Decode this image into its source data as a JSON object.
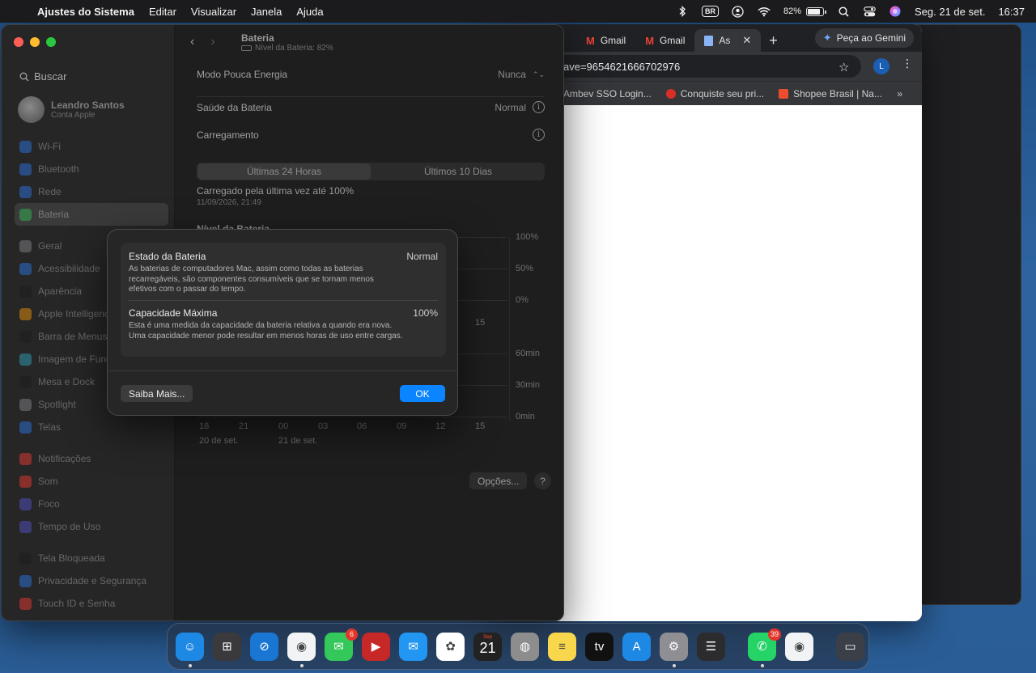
{
  "menubar": {
    "app_name": "Ajustes do Sistema",
    "menus": [
      "Editar",
      "Visualizar",
      "Janela",
      "Ajuda"
    ],
    "input_source": "BR",
    "battery_percent": "82%",
    "date": "Seg. 21 de set.",
    "time": "16:37"
  },
  "chrome": {
    "tabs": [
      {
        "label": "Gmail"
      },
      {
        "label": "Gmail"
      },
      {
        "label": "As"
      }
    ],
    "gemini_label": "Peça ao Gemini",
    "address": "ave=9654621666702976",
    "profile_initial": "L",
    "bookmarks": [
      {
        "label": "Ambev SSO Login...",
        "color": "#9e9e9e"
      },
      {
        "label": "Conquiste seu pri...",
        "color": "#d93025"
      },
      {
        "label": "Shopee Brasil | Na...",
        "color": "#ee4d2d"
      }
    ]
  },
  "sidebar": {
    "search_placeholder": "Buscar",
    "user_name": "Leandro Santos",
    "user_sub": "Conta Apple",
    "groups": [
      [
        {
          "label": "Wi-Fi",
          "color": "#2f7cf6"
        },
        {
          "label": "Bluetooth",
          "color": "#2f7cf6"
        },
        {
          "label": "Rede",
          "color": "#2f7cf6"
        },
        {
          "label": "Bateria",
          "color": "#34c759",
          "selected": true
        }
      ],
      [
        {
          "label": "Geral",
          "color": "#8e8e93"
        },
        {
          "label": "Acessibilidade",
          "color": "#2f7cf6"
        },
        {
          "label": "Aparência",
          "color": "#1c1c1e"
        },
        {
          "label": "Apple Intelligence",
          "color": "#ff9f0a"
        },
        {
          "label": "Barra de Menus",
          "color": "#1c1c1e"
        },
        {
          "label": "Imagem de Fundo",
          "color": "#30b0c7"
        },
        {
          "label": "Mesa e Dock",
          "color": "#1c1c1e"
        },
        {
          "label": "Spotlight",
          "color": "#8e8e93"
        },
        {
          "label": "Telas",
          "color": "#2f7cf6"
        }
      ],
      [
        {
          "label": "Notificações",
          "color": "#ff3b30"
        },
        {
          "label": "Som",
          "color": "#ff3b30"
        },
        {
          "label": "Foco",
          "color": "#5856d6"
        },
        {
          "label": "Tempo de Uso",
          "color": "#5856d6"
        }
      ],
      [
        {
          "label": "Tela Bloqueada",
          "color": "#1c1c1e"
        },
        {
          "label": "Privacidade e Segurança",
          "color": "#2f7cf6"
        },
        {
          "label": "Touch ID e Senha",
          "color": "#ff3b30"
        }
      ]
    ]
  },
  "main": {
    "title": "Bateria",
    "subtitle": "Nível da Bateria: 82%",
    "low_power_label": "Modo Pouca Energia",
    "low_power_value": "Nunca",
    "health_label": "Saúde da Bateria",
    "health_value": "Normal",
    "charging_label": "Carregamento",
    "seg_24h": "Últimas 24 Horas",
    "seg_10d": "Últimos 10 Dias",
    "charged_text": "Carregado pela última vez até 100%",
    "charged_time": "11/09/2026, 21:49",
    "level_title": "Nível da Bateria",
    "y_labels_level": [
      "100%",
      "50%",
      "0%"
    ],
    "y_labels_usage": [
      "60min",
      "30min",
      "0min"
    ],
    "x_partial_15": "15",
    "x_labels": [
      "18",
      "21",
      "00",
      "03",
      "06",
      "09",
      "12",
      "15"
    ],
    "date_labels": [
      "20 de set.",
      "21 de set."
    ],
    "options_label": "Opções...",
    "help_label": "?"
  },
  "sheet": {
    "state_title": "Estado da Bateria",
    "state_value": "Normal",
    "state_desc": "As baterias de computadores Mac, assim como todas as baterias recarregáveis, são componentes consumíveis que se tornam menos efetivos com o passar do tempo.",
    "capacity_title": "Capacidade Máxima",
    "capacity_value": "100%",
    "capacity_desc": "Esta é uma medida da capacidade da bateria relativa a quando era nova. Uma capacidade menor pode resultar em menos horas de uso entre cargas.",
    "learn_more": "Saiba Mais...",
    "ok": "OK"
  },
  "dock": {
    "apps": [
      {
        "name": "finder",
        "color": "#1e88e5",
        "glyph": "☺",
        "running": true
      },
      {
        "name": "launchpad",
        "color": "#3a3a3c",
        "glyph": "⊞"
      },
      {
        "name": "safari",
        "color": "#1976d2",
        "glyph": "⊘"
      },
      {
        "name": "chrome",
        "color": "#f1f3f4",
        "glyph": "◉",
        "running": true
      },
      {
        "name": "messages",
        "color": "#34c759",
        "glyph": "✉",
        "badge": "6"
      },
      {
        "name": "youtube",
        "color": "#c62828",
        "glyph": "▶"
      },
      {
        "name": "mail",
        "color": "#2196f3",
        "glyph": "✉"
      },
      {
        "name": "photos",
        "color": "#ffffff",
        "glyph": "✿"
      },
      {
        "name": "calendar",
        "color": "#222222",
        "month": "Sep",
        "day": "21"
      },
      {
        "name": "contacts",
        "color": "#8d8d8d",
        "glyph": "◍"
      },
      {
        "name": "notes",
        "color": "#f9d74c",
        "glyph": "≡"
      },
      {
        "name": "tv",
        "color": "#111111",
        "glyph": "tv"
      },
      {
        "name": "app-store",
        "color": "#1e88e5",
        "glyph": "A"
      },
      {
        "name": "system-settings",
        "color": "#8e8e93",
        "glyph": "⚙",
        "running": true
      },
      {
        "name": "reminders",
        "color": "#2c2c2e",
        "glyph": "☰"
      }
    ],
    "recent_apps": [
      {
        "name": "whatsapp",
        "color": "#25d366",
        "glyph": "✆",
        "badge": "39",
        "running": true
      },
      {
        "name": "chrome-profile",
        "color": "#f1f3f4",
        "glyph": "◉"
      }
    ],
    "trash": {
      "name": "trash",
      "color": "#3a3f48",
      "glyph": "▭"
    }
  }
}
